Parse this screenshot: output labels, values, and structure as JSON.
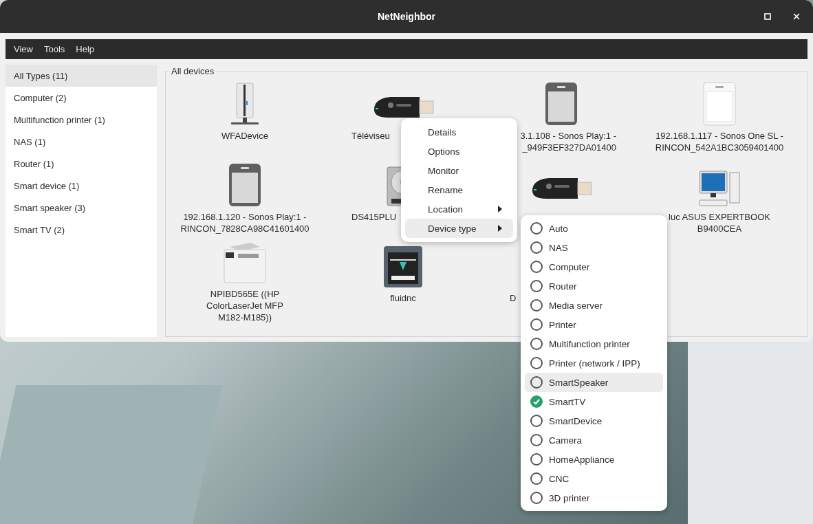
{
  "window": {
    "title": "NetNeighbor"
  },
  "menu_bar": [
    "View",
    "Tools",
    "Help"
  ],
  "sidebar": {
    "items": [
      {
        "label": "All Types (11)",
        "selected": true
      },
      {
        "label": "Computer (2)",
        "selected": false
      },
      {
        "label": "Multifunction printer (1)",
        "selected": false
      },
      {
        "label": "NAS (1)",
        "selected": false
      },
      {
        "label": "Router (1)",
        "selected": false
      },
      {
        "label": "Smart device (1)",
        "selected": false
      },
      {
        "label": "Smart speaker (3)",
        "selected": false
      },
      {
        "label": "Smart TV (2)",
        "selected": false
      }
    ]
  },
  "devices": {
    "title": "All devices",
    "items": [
      {
        "kind": "nas",
        "lines": [
          "WFADevice"
        ],
        "cut_end": false,
        "cut_start": false
      },
      {
        "kind": "dongle",
        "lines": [
          "Téléviseu"
        ],
        "cut_end": true,
        "cut_start": false
      },
      {
        "kind": "speaker-dark",
        "lines": [
          "3.1.108 - Sonos Play:1 -",
          "_949F3EF327DA01400"
        ],
        "cut_end": false,
        "cut_start": true
      },
      {
        "kind": "speaker-white",
        "lines": [
          "192.168.1.117 - Sonos One SL -",
          "RINCON_542A1BC3059401400"
        ],
        "cut_end": false,
        "cut_start": false
      },
      {
        "kind": "speaker-dark",
        "lines": [
          "192.168.1.120 - Sonos Play:1 -",
          "RINCON_7828CA98C41601400"
        ],
        "cut_end": false,
        "cut_start": false
      },
      {
        "kind": "harddrive",
        "lines": [
          "DS415PLU"
        ],
        "cut_end": true,
        "cut_start": false
      },
      {
        "kind": "dongle"
      },
      {
        "kind": "computer",
        "lines": [
          "luc ASUS EXPERTBOOK",
          "B9400CEA"
        ],
        "cut_end": false,
        "cut_start": false
      },
      {
        "kind": "printer",
        "lines": [
          "NPIBD565E ((HP",
          "ColorLaserJet MFP",
          "M182-M185))"
        ],
        "cut_end": false,
        "cut_start": false
      },
      {
        "kind": "printer3d",
        "lines": [
          "fluidnc"
        ],
        "cut_end": false,
        "cut_start": false
      },
      {
        "kind": "hidden",
        "lines": [
          "D"
        ],
        "cut_end": true,
        "cut_start": false
      }
    ]
  },
  "context_menu": {
    "items": [
      {
        "label": "Details",
        "submenu": false,
        "selected": false
      },
      {
        "label": "Options",
        "submenu": false,
        "selected": false
      },
      {
        "label": "Monitor",
        "submenu": false,
        "selected": false
      },
      {
        "label": "Rename",
        "submenu": false,
        "selected": false
      },
      {
        "label": "Location",
        "submenu": true,
        "selected": false
      },
      {
        "label": "Device type",
        "submenu": true,
        "selected": true
      }
    ]
  },
  "device_type_menu": {
    "items": [
      {
        "label": "Auto",
        "checked": false,
        "selected": false
      },
      {
        "label": "NAS",
        "checked": false,
        "selected": false
      },
      {
        "label": "Computer",
        "checked": false,
        "selected": false
      },
      {
        "label": "Router",
        "checked": false,
        "selected": false
      },
      {
        "label": "Media server",
        "checked": false,
        "selected": false
      },
      {
        "label": "Printer",
        "checked": false,
        "selected": false
      },
      {
        "label": "Multifunction printer",
        "checked": false,
        "selected": false
      },
      {
        "label": "Printer (network / IPP)",
        "checked": false,
        "selected": false
      },
      {
        "label": "SmartSpeaker",
        "checked": false,
        "selected": true
      },
      {
        "label": "SmartTV",
        "checked": true,
        "selected": false
      },
      {
        "label": "SmartDevice",
        "checked": false,
        "selected": false
      },
      {
        "label": "Camera",
        "checked": false,
        "selected": false
      },
      {
        "label": "HomeAppliance",
        "checked": false,
        "selected": false
      },
      {
        "label": "CNC",
        "checked": false,
        "selected": false
      },
      {
        "label": "3D printer",
        "checked": false,
        "selected": false
      }
    ]
  }
}
